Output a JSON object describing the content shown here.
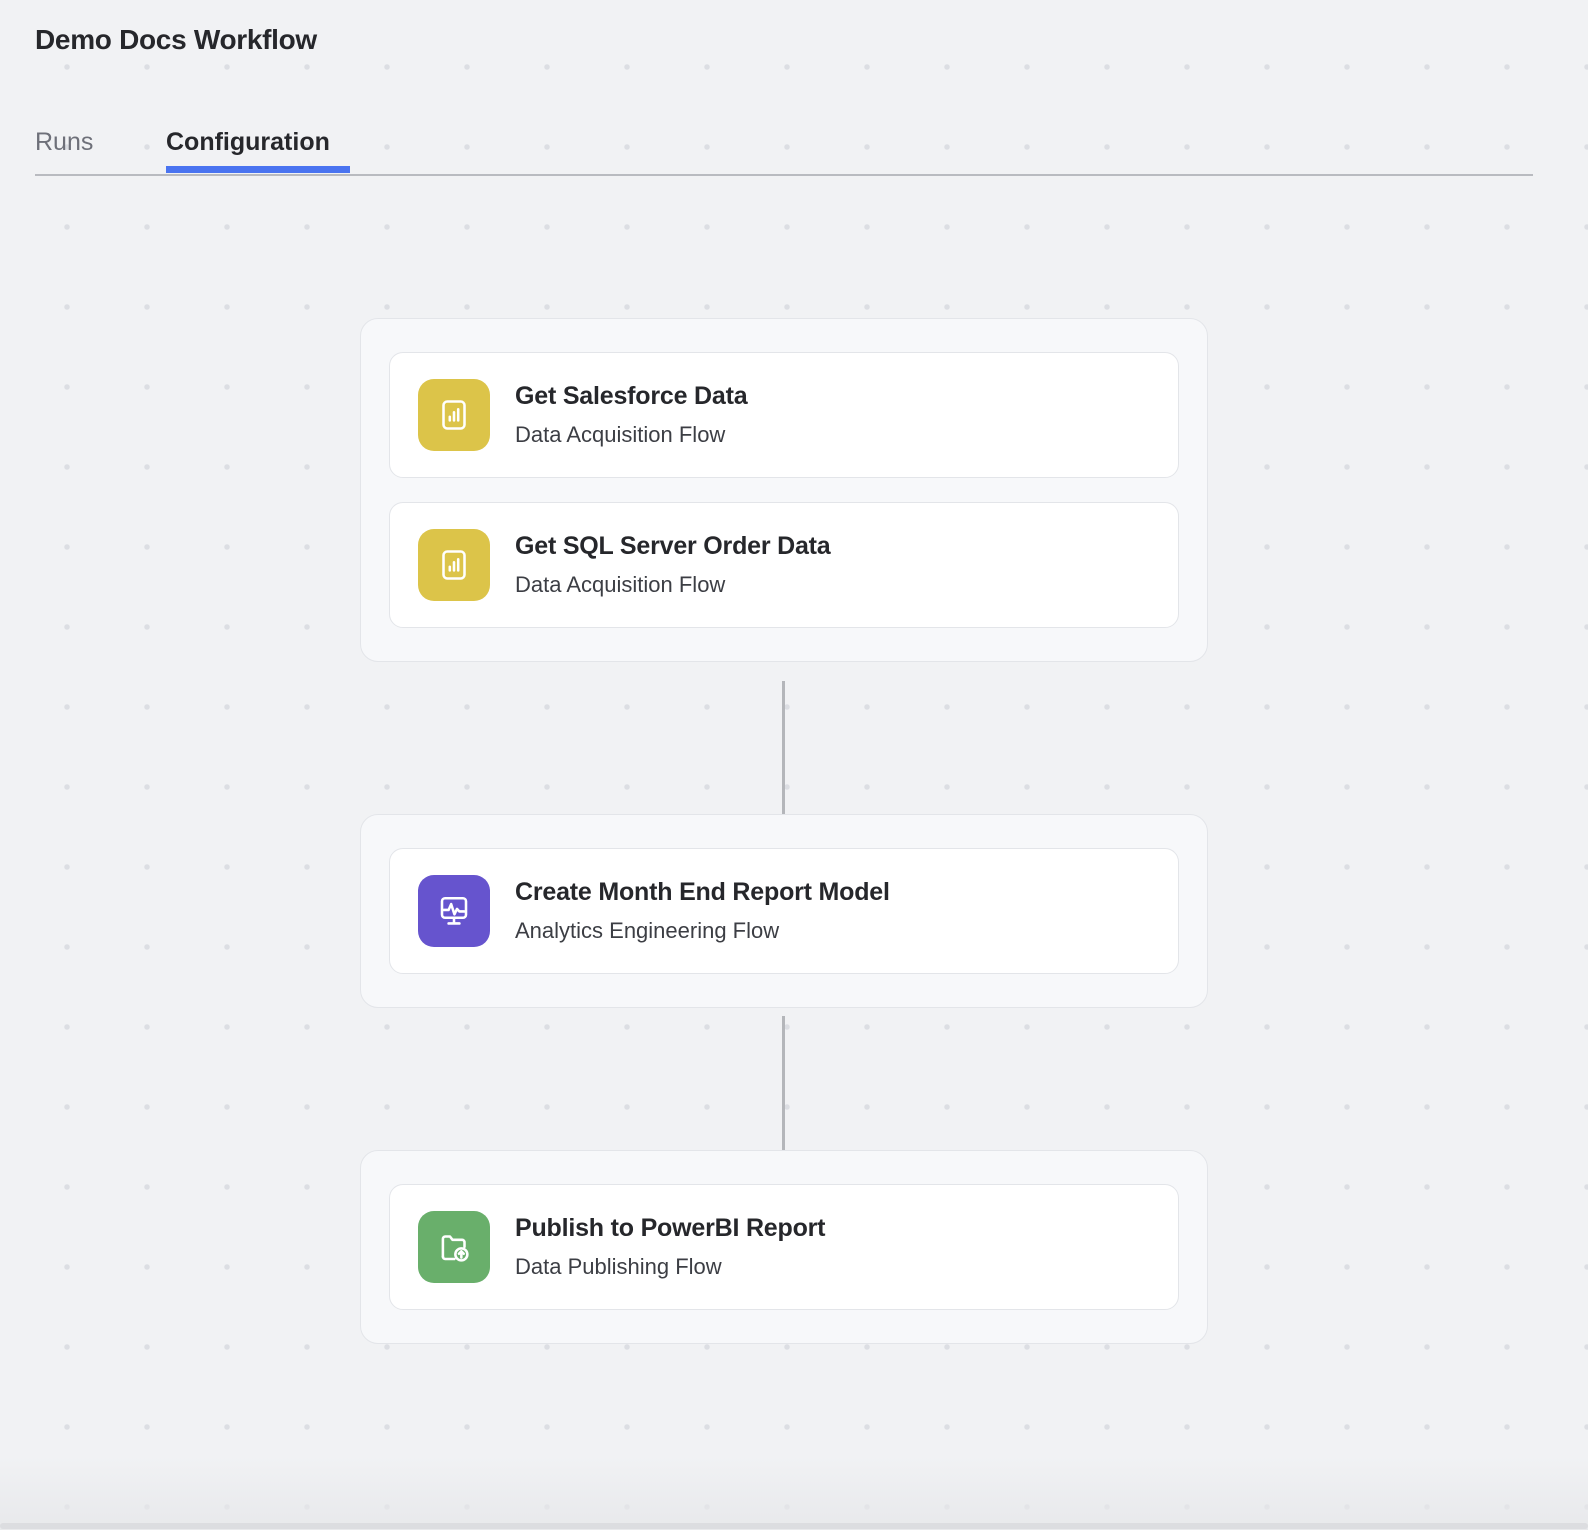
{
  "header": {
    "title": "Demo Docs Workflow"
  },
  "tabs": [
    {
      "label": "Runs",
      "active": false
    },
    {
      "label": "Configuration",
      "active": true
    }
  ],
  "colors": {
    "accent_blue": "#4a74f0",
    "data_acquisition_yellow": "#dcc449",
    "analytics_purple": "#6654ce",
    "publishing_green": "#69af6b",
    "canvas_background": "#f1f2f4",
    "group_background": "#f7f8fa",
    "card_background": "#ffffff",
    "border": "#e3e5e9",
    "connector": "#b4b6ba",
    "title_text": "#26272b",
    "muted_text": "#6e7079"
  },
  "workflow": {
    "groups": [
      {
        "nodes": [
          {
            "title": "Get Salesforce Data",
            "subtitle": "Data Acquisition Flow",
            "icon": "bar-chart-report-icon",
            "icon_color": "#dcc449"
          },
          {
            "title": "Get SQL Server Order Data",
            "subtitle": "Data Acquisition Flow",
            "icon": "bar-chart-report-icon",
            "icon_color": "#dcc449"
          }
        ]
      },
      {
        "nodes": [
          {
            "title": "Create Month End Report Model",
            "subtitle": "Analytics Engineering Flow",
            "icon": "monitor-pulse-icon",
            "icon_color": "#6654ce"
          }
        ]
      },
      {
        "nodes": [
          {
            "title": "Publish to PowerBI Report",
            "subtitle": "Data Publishing Flow",
            "icon": "folder-upload-icon",
            "icon_color": "#69af6b"
          }
        ]
      }
    ]
  }
}
